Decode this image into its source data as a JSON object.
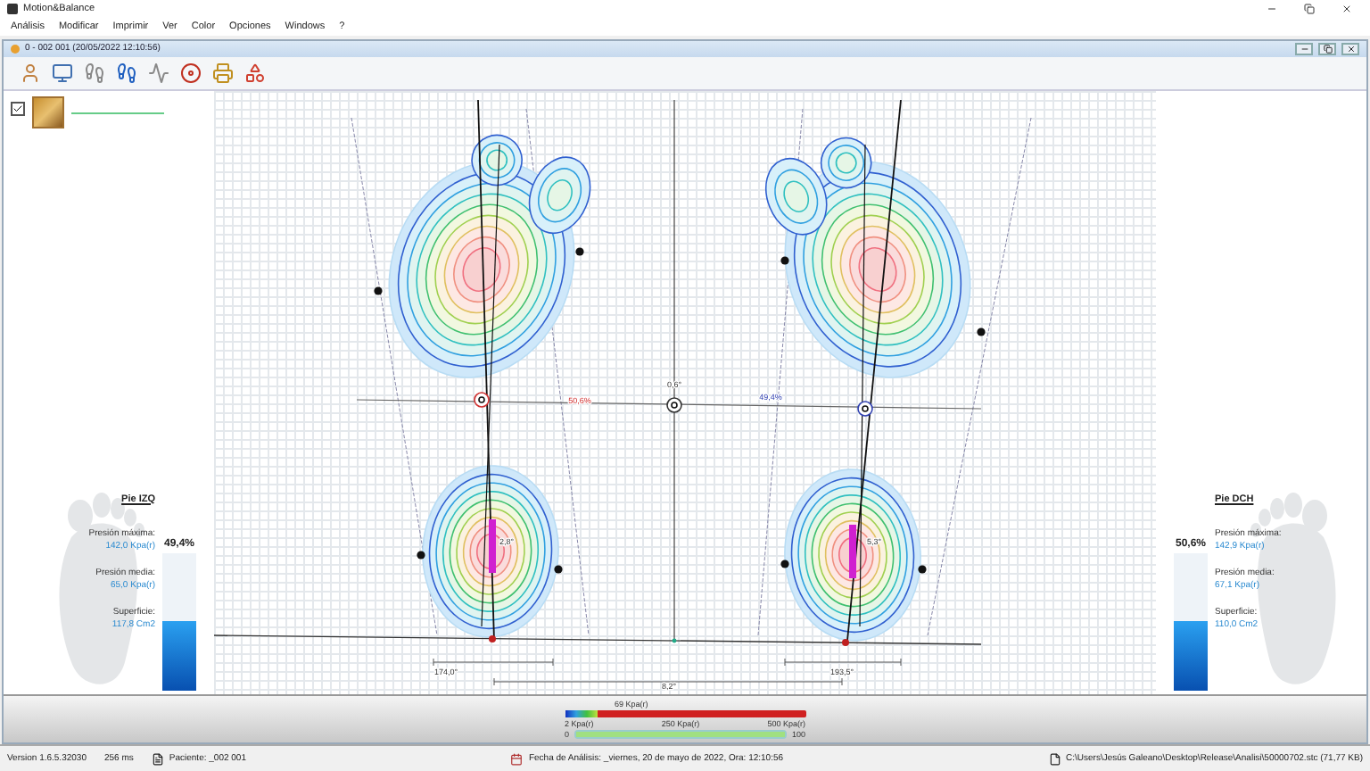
{
  "app": {
    "title": "Motion&Balance"
  },
  "menu": [
    "Análisis",
    "Modificar",
    "Imprimir",
    "Ver",
    "Color",
    "Opciones",
    "Windows",
    "?"
  ],
  "document": {
    "title": "0 - 002 001 (20/05/2022 12:10:56)"
  },
  "sidebar": {
    "checked": true
  },
  "feet": [
    {
      "name": "Pie IZQ",
      "max_label": "Presión máxima:",
      "max_value": "142,0 Kpa(r)",
      "mean_label": "Presión media:",
      "mean_value": "65,0 Kpa(r)",
      "area_label": "Superficie:",
      "area_value": "117,8 Cm2",
      "share": "49,4%",
      "level": 0.494
    },
    {
      "name": "Pie DCH",
      "max_label": "Presión máxima:",
      "max_value": "142,9 Kpa(r)",
      "mean_label": "Presión media:",
      "mean_value": "67,1 Kpa(r)",
      "area_label": "Superficie:",
      "area_value": "110,0 Cm2",
      "share": "50,6%",
      "level": 0.506
    }
  ],
  "map": {
    "left_share": "50,6%",
    "center_angle": "0,6°",
    "right_share": "49,4%",
    "left_heel_angle": "2,8°",
    "right_heel_angle": "5,3°",
    "left_width": "174,0°",
    "right_width": "193,5°",
    "base_angle": "8,2°"
  },
  "scale": {
    "current": "69 Kpa(r)",
    "level": 0.138,
    "min": "2 Kpa(r)",
    "mid": "250 Kpa(r)",
    "max": "500 Kpa(r)",
    "range": {
      "min": "0",
      "max": "100",
      "level": 1
    }
  },
  "status_bar": {
    "version": "Version 1.6.5.32030",
    "timing": "256 ms",
    "patient": "Paciente: _002 001",
    "date": "Fecha de Análisis: _viernes, 20 de mayo de 2022, Ora: 12:10:56",
    "file": "C:\\Users\\Jesús Galeano\\Desktop\\Release\\Analisi\\50000702.stc  (71,77 KB)"
  }
}
